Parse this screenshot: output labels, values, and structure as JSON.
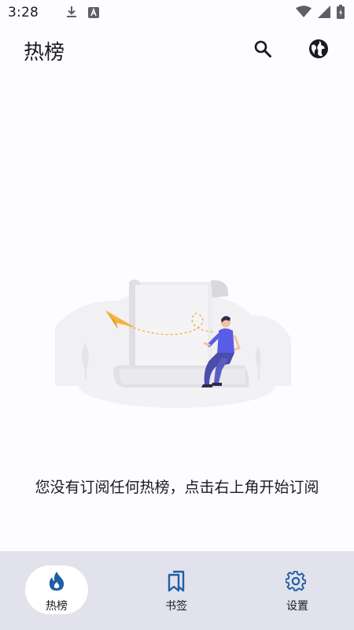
{
  "status_bar": {
    "time": "3:28",
    "icons": [
      "download-icon",
      "a-badge-icon",
      "wifi-icon",
      "signal-icon",
      "battery-icon"
    ]
  },
  "app_bar": {
    "title": "热榜",
    "actions": [
      "search-icon",
      "globe-icon"
    ]
  },
  "empty_state": {
    "message": "您没有订阅任何热榜，点击右上角开始订阅",
    "illustration": "paper-plane-and-person-on-scroll"
  },
  "bottom_nav": {
    "items": [
      {
        "label": "热榜",
        "icon": "flame-icon",
        "active": true
      },
      {
        "label": "书签",
        "icon": "bookmarks-icon",
        "active": false
      },
      {
        "label": "设置",
        "icon": "gear-icon",
        "active": false
      }
    ]
  },
  "colors": {
    "background": "#fdfcff",
    "nav_background": "#e1e2ec",
    "accent": "#1f5fa6",
    "person_shirt": "#5b5ce6",
    "paper_plane": "#f5b23a"
  }
}
